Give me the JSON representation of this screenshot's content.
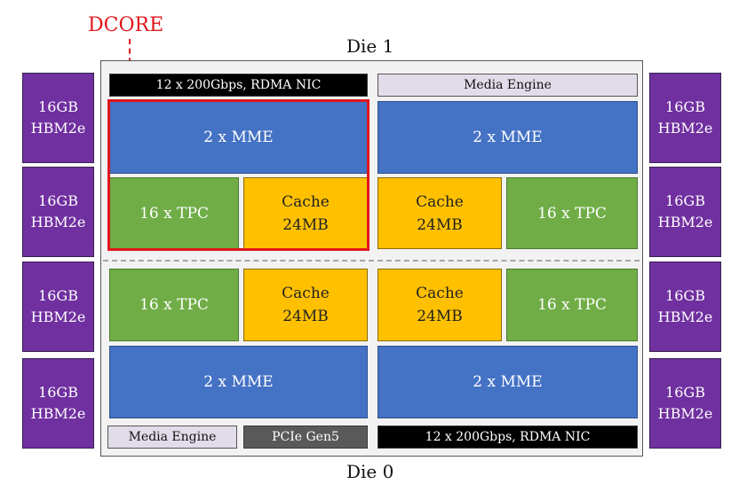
{
  "dcore_label": "DCORE",
  "die_top_label": "Die 1",
  "die_bottom_label": "Die 0",
  "colors": {
    "hbm": "#7030a0",
    "mme": "#4472c4",
    "tpc": "#70ad47",
    "cache": "#ffc000",
    "nic": "#000000",
    "media": "#e2dcea",
    "pcie": "#595959",
    "dcore_highlight": "#e0161b"
  },
  "hbm_left": [
    {
      "line1": "16GB",
      "line2": "HBM2e"
    },
    {
      "line1": "16GB",
      "line2": "HBM2e"
    },
    {
      "line1": "16GB",
      "line2": "HBM2e"
    },
    {
      "line1": "16GB",
      "line2": "HBM2e"
    }
  ],
  "hbm_right": [
    {
      "line1": "16GB",
      "line2": "HBM2e"
    },
    {
      "line1": "16GB",
      "line2": "HBM2e"
    },
    {
      "line1": "16GB",
      "line2": "HBM2e"
    },
    {
      "line1": "16GB",
      "line2": "HBM2e"
    }
  ],
  "die1": {
    "nic": "12 x 200Gbps, RDMA NIC",
    "media": "Media Engine",
    "left_mme": "2 x MME",
    "right_mme": "2 x MME",
    "left_tpc": "16 x TPC",
    "left_cache": {
      "line1": "Cache",
      "line2": "24MB"
    },
    "right_cache": {
      "line1": "Cache",
      "line2": "24MB"
    },
    "right_tpc": "16 x TPC"
  },
  "die0": {
    "left_tpc": "16 x TPC",
    "left_cache": {
      "line1": "Cache",
      "line2": "24MB"
    },
    "right_cache": {
      "line1": "Cache",
      "line2": "24MB"
    },
    "right_tpc": "16 x TPC",
    "left_mme": "2 x MME",
    "right_mme": "2 x MME",
    "media": "Media Engine",
    "pcie": "PCIe Gen5",
    "nic": "12 x 200Gbps, RDMA NIC"
  }
}
